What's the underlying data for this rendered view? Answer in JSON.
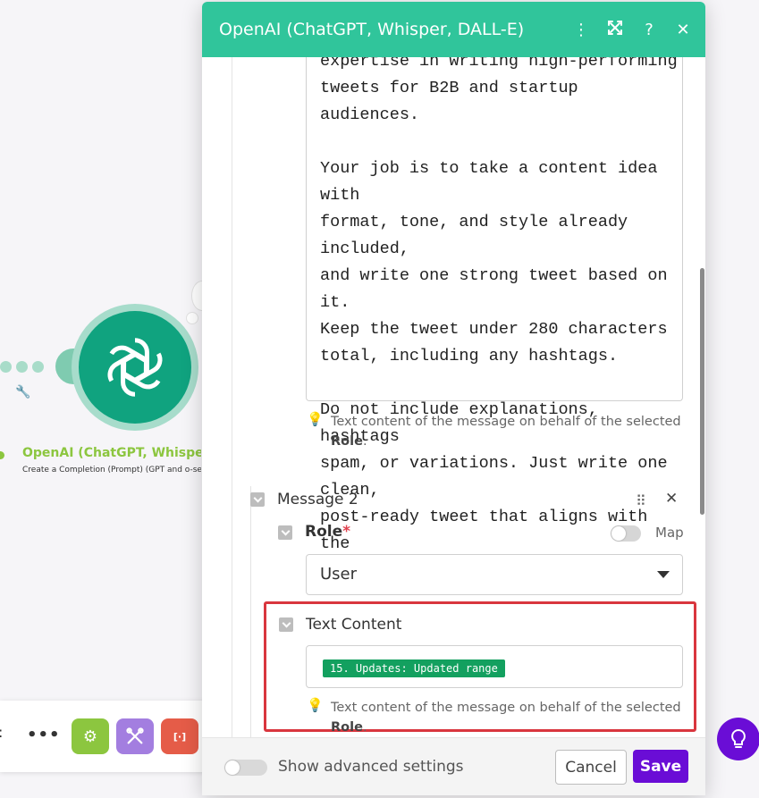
{
  "modal": {
    "title": "OpenAI (ChatGPT, Whisper, DALL-E)"
  },
  "canvas": {
    "module_title": "OpenAI (ChatGPT, Whisper, D",
    "module_subtitle": "Create a Completion (Prompt) (GPT and o-ser"
  },
  "toolbar": {
    "more_label": "•••",
    "edge_label": ":",
    "orange_label": "[·]"
  },
  "message1": {
    "text": "expertise in writing high-performing\ntweets for B2B and startup audiences.\n\nYour job is to take a content idea with\nformat, tone, and style already included,\nand write one strong tweet based on it.\nKeep the tweet under 280 characters\ntotal, including any hashtags.\n\nDo not include explanations, hashtags\nspam, or variations. Just write one clean,\npost-ready tweet that aligns with the\ninstructions.",
    "hint_prefix": "Text content of the message on behalf of the selected",
    "hint_bold": "Role",
    "hint_suffix": "."
  },
  "message2": {
    "label": "Message 2",
    "role_label": "Role",
    "required_mark": "*",
    "map_label": "Map",
    "role_value": "User",
    "text_content_label": "Text Content",
    "text_content_pill": "15. Updates: Updated range",
    "hint_prefix": "Text content of the message on behalf of the selected",
    "hint_bold": "Role",
    "hint_suffix": "."
  },
  "footer": {
    "advanced_label": "Show advanced settings",
    "cancel_label": "Cancel",
    "save_label": "Save"
  },
  "colors": {
    "header": "#30c59b",
    "module": "#10a37f",
    "accent": "#6a0dd6",
    "highlight": "#d9363e",
    "pill": "#13a05f"
  },
  "icons": {
    "kebab": "kebab-icon",
    "expand": "expand-icon",
    "help": "help-icon",
    "close": "close-icon",
    "drag": "drag-handle-icon",
    "bulb": "lightbulb-icon"
  }
}
